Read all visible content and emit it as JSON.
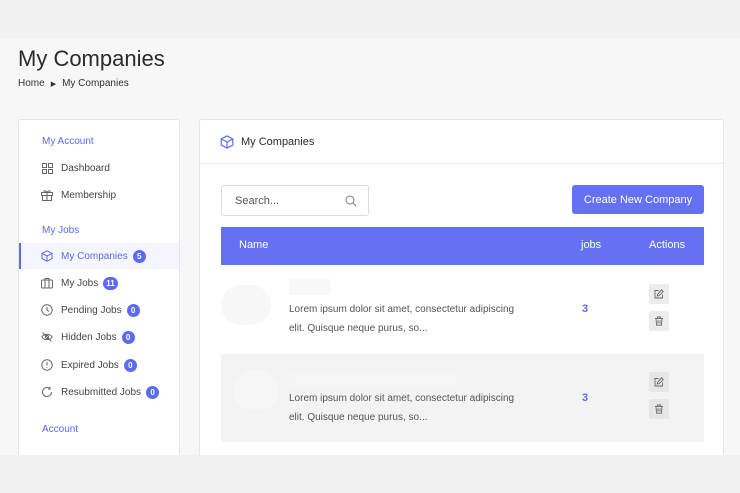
{
  "page": {
    "title": "My Companies",
    "breadcrumb": [
      "Home",
      "My Companies"
    ]
  },
  "sidebar": {
    "sections": [
      {
        "label": "My Account"
      },
      {
        "label": "My Jobs"
      },
      {
        "label": "Account"
      }
    ],
    "items": [
      {
        "label": "Dashboard",
        "icon": "grid-icon"
      },
      {
        "label": "Membership",
        "icon": "gift-icon"
      },
      {
        "label": "My Companies",
        "icon": "cube-icon",
        "badge": "5",
        "active": true
      },
      {
        "label": "My Jobs",
        "icon": "briefcase-icon",
        "badge": "11"
      },
      {
        "label": "Pending Jobs",
        "icon": "clock-icon",
        "badge": "0"
      },
      {
        "label": "Hidden Jobs",
        "icon": "eye-off-icon",
        "badge": "0"
      },
      {
        "label": "Expired Jobs",
        "icon": "alert-circle-icon",
        "badge": "0"
      },
      {
        "label": "Resubmitted Jobs",
        "icon": "refresh-icon",
        "badge": "0"
      }
    ]
  },
  "main": {
    "header_title": "My Companies",
    "search_placeholder": "Search...",
    "create_button": "Create New Company",
    "table": {
      "columns": [
        "Name",
        "jobs",
        "Actions"
      ],
      "rows": [
        {
          "description_line1": "Lorem ipsum dolor sit amet, consectetur adipiscing",
          "description_line2": "elit. Quisque neque purus, so...",
          "jobs": "3"
        },
        {
          "description_line1": "Lorem ipsum dolor sit amet, consectetur adipiscing",
          "description_line2": "elit. Quisque neque purus, so...",
          "jobs": "3"
        }
      ]
    }
  },
  "colors": {
    "accent": "#6571f5",
    "page_bg": "#f7f7f7",
    "row_alt": "#f3f3f3"
  }
}
